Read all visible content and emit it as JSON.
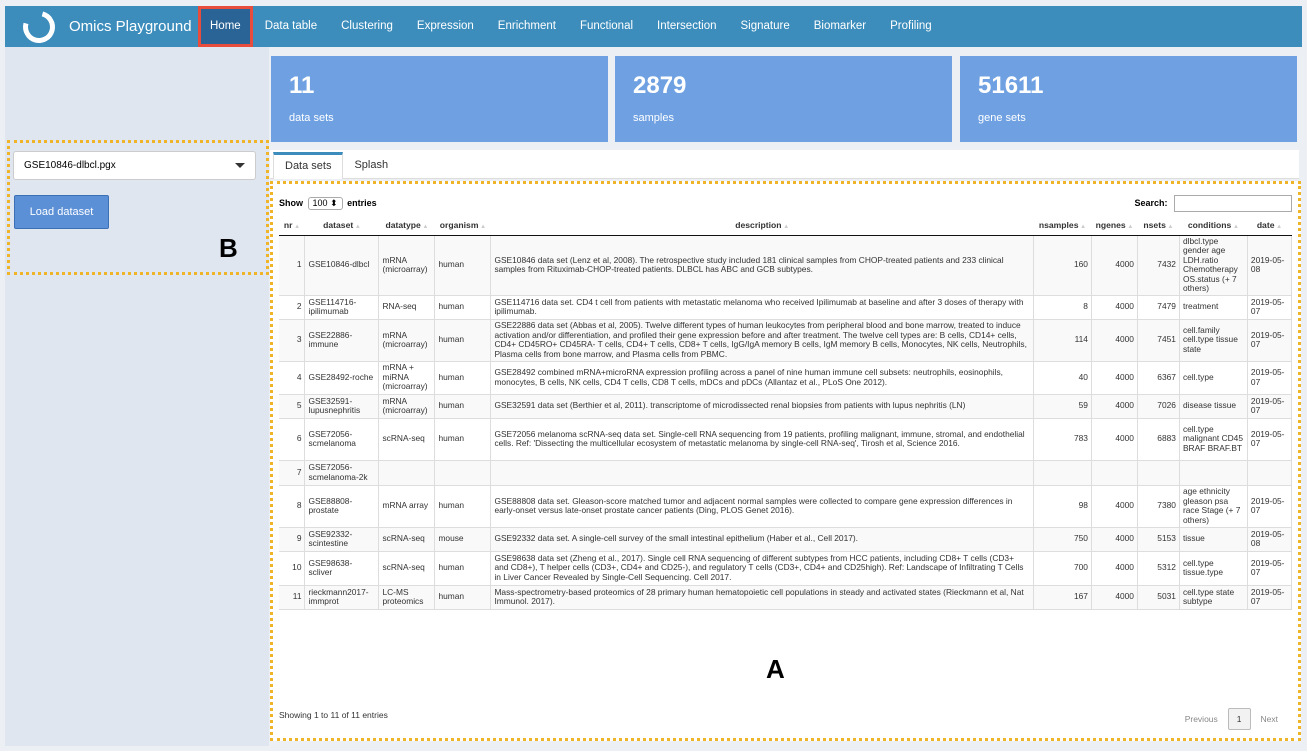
{
  "app": {
    "title": "Omics Playground"
  },
  "nav": [
    "Home",
    "Data table",
    "Clustering",
    "Expression",
    "Enrichment",
    "Functional",
    "Intersection",
    "Signature",
    "Biomarker",
    "Profiling"
  ],
  "sidebar": {
    "dataset_select": "GSE10846-dlbcl.pgx",
    "load_button": "Load dataset",
    "callout": "B"
  },
  "stats": [
    {
      "value": "11",
      "label": "data sets"
    },
    {
      "value": "2879",
      "label": "samples"
    },
    {
      "value": "51611",
      "label": "gene sets"
    }
  ],
  "tabs": [
    "Data sets",
    "Splash"
  ],
  "table": {
    "show_label": "Show",
    "length": "100",
    "entries_label": "entries",
    "search_label": "Search:",
    "columns": [
      "nr",
      "dataset",
      "datatype",
      "organism",
      "description",
      "nsamples",
      "ngenes",
      "nsets",
      "conditions",
      "date"
    ],
    "rows": [
      [
        "1",
        "GSE10846-dlbcl",
        "mRNA (microarray)",
        "human",
        "GSE10846 data set (Lenz et al, 2008). The retrospective study included 181 clinical samples from CHOP-treated patients and 233 clinical samples from Rituximab-CHOP-treated patients. DLBCL has ABC and GCB subtypes.",
        "160",
        "4000",
        "7432",
        "dlbcl.type gender age LDH.ratio Chemotherapy OS.status (+ 7 others)",
        "2019-05-08"
      ],
      [
        "2",
        "GSE114716-ipilimumab",
        "RNA-seq",
        "human",
        "GSE114716 data set. CD4 t cell from patients with metastatic melanoma who received Ipilimumab at baseline and after 3 doses of therapy with ipilimumab.",
        "8",
        "4000",
        "7479",
        "treatment",
        "2019-05-07"
      ],
      [
        "3",
        "GSE22886-immune",
        "mRNA (microarray)",
        "human",
        "GSE22886 data set (Abbas et al, 2005). Twelve different types of human leukocytes from peripheral blood and bone marrow, treated to induce activation and/or differentiation, and profiled their gene expression before and after treatment. The twelve cell types are: B cells, CD14+ cells, CD4+ CD45RO+ CD45RA- T cells, CD4+ T cells, CD8+ T cells, IgG/IgA memory B cells, IgM memory B cells, Monocytes, NK cells, Neutrophils, Plasma cells from bone marrow, and Plasma cells from PBMC.",
        "114",
        "4000",
        "7451",
        "cell.family cell.type tissue state",
        "2019-05-07"
      ],
      [
        "4",
        "GSE28492-roche",
        "mRNA + miRNA (microarray)",
        "human",
        "GSE28492 combined mRNA+microRNA expression profiling across a panel of nine human immune cell subsets: neutrophils, eosinophils, monocytes, B cells, NK cells, CD4 T cells, CD8 T cells, mDCs and pDCs (Allantaz et al., PLoS One 2012).",
        "40",
        "4000",
        "6367",
        "cell.type",
        "2019-05-07"
      ],
      [
        "5",
        "GSE32591-lupusnephritis",
        "mRNA (microarray)",
        "human",
        "GSE32591 data set (Berthier et al, 2011). transcriptome of microdissected renal biopsies from patients with lupus nephritis (LN)",
        "59",
        "4000",
        "7026",
        "disease tissue",
        "2019-05-07"
      ],
      [
        "6",
        "GSE72056-scmelanoma",
        "scRNA-seq",
        "human",
        "GSE72056 melanoma scRNA-seq data set. Single-cell RNA sequencing from 19 patients, profiling malignant, immune, stromal, and endothelial cells. Ref: 'Dissecting the multicellular ecosystem of metastatic melanoma by single-cell RNA-seq', Tirosh et al, Science 2016.",
        "783",
        "4000",
        "6883",
        "cell.type malignant CD45 BRAF BRAF.BT",
        "2019-05-07"
      ],
      [
        "7",
        "GSE72056-scmelanoma-2k",
        "",
        "",
        "",
        "",
        "",
        "",
        "",
        ""
      ],
      [
        "8",
        "GSE88808-prostate",
        "mRNA array",
        "human",
        "GSE88808 data set. Gleason-score matched tumor and adjacent normal samples were collected to compare gene expression differences in early-onset versus late-onset prostate cancer patients (Ding, PLOS Genet 2016).",
        "98",
        "4000",
        "7380",
        "age ethnicity gleason psa race Stage (+ 7 others)",
        "2019-05-07"
      ],
      [
        "9",
        "GSE92332-scintestine",
        "scRNA-seq",
        "mouse",
        "GSE92332 data set. A single-cell survey of the small intestinal epithelium (Haber et al., Cell 2017).",
        "750",
        "4000",
        "5153",
        "tissue",
        "2019-05-08"
      ],
      [
        "10",
        "GSE98638-scliver",
        "scRNA-seq",
        "human",
        "GSE98638 data set (Zheng et al., 2017). Single cell RNA sequencing of different subtypes from HCC patients, including CD8+ T cells (CD3+ and CD8+), T helper cells (CD3+, CD4+ and CD25-), and regulatory T cells (CD3+, CD4+ and CD25high). Ref: Landscape of Infiltrating T Cells in Liver Cancer Revealed by Single-Cell Sequencing. Cell 2017.",
        "700",
        "4000",
        "5312",
        "cell.type tissue.type",
        "2019-05-07"
      ],
      [
        "11",
        "rieckmann2017-immprot",
        "LC-MS proteomics",
        "human",
        "Mass-spectrometry-based proteomics of 28 primary human hematopoietic cell populations in steady and activated states (Rieckmann et al, Nat Immunol. 2017).",
        "167",
        "4000",
        "5031",
        "cell.type state subtype",
        "2019-05-07"
      ]
    ],
    "info": "Showing 1 to 11 of 11 entries",
    "pager": {
      "previous": "Previous",
      "current": "1",
      "next": "Next"
    },
    "callout": "A"
  }
}
